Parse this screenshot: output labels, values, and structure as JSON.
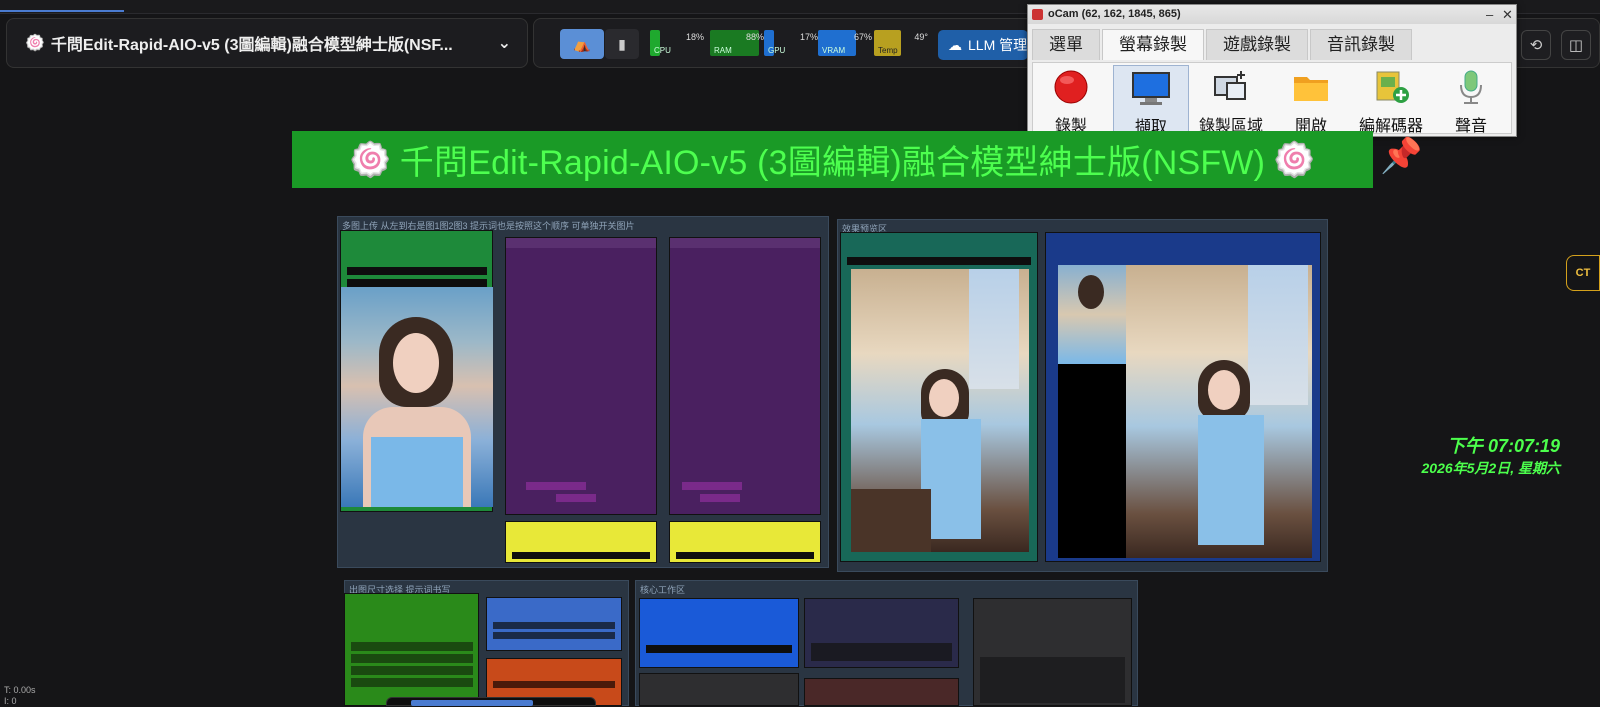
{
  "workflow": {
    "title": "千問Edit-Rapid-AIO-v5 (3圖編輯)融合模型紳士版(NSF..."
  },
  "monitors": [
    {
      "label": "CPU",
      "value": "18%",
      "color": "#1fa92e",
      "fill": 0.18
    },
    {
      "label": "RAM",
      "value": "88%",
      "color": "#1a7a22",
      "fill": 0.88
    },
    {
      "label": "GPU",
      "value": "17%",
      "color": "#1f6fd0",
      "fill": 0.17
    },
    {
      "label": "VRAM",
      "value": "67%",
      "color": "#1f6fd0",
      "fill": 0.67
    },
    {
      "label": "Temp",
      "value": "49°",
      "color": "#b8a020",
      "fill": 0.49
    }
  ],
  "llm_button": "LLM 管理",
  "ocam": {
    "title": "oCam (62, 162, 1845, 865)",
    "tabs": [
      "選單",
      "螢幕錄製",
      "遊戲錄製",
      "音訊錄製"
    ],
    "active_tab": 1,
    "buttons": [
      "錄製",
      "擷取",
      "錄製區域",
      "開啟",
      "編解碼器",
      "聲音"
    ]
  },
  "banner": {
    "title": "千問Edit-Rapid-AIO-v5 (3圖編輯)融合模型紳士版(NSFW)"
  },
  "groups": {
    "upload": "多图上传 从左到右是图1图2图3 提示词也是按照这个顺序 可单独开关图片",
    "preview": "效果预览区",
    "size": "出图尺寸选择 提示词书写",
    "core": "核心工作区"
  },
  "clock": {
    "time": "下午 07:07:19",
    "date": "2026年5月2日, 星期六"
  },
  "ct_badge": "CT",
  "stats": {
    "time": "T: 0.00s",
    "count": "I: 0"
  }
}
